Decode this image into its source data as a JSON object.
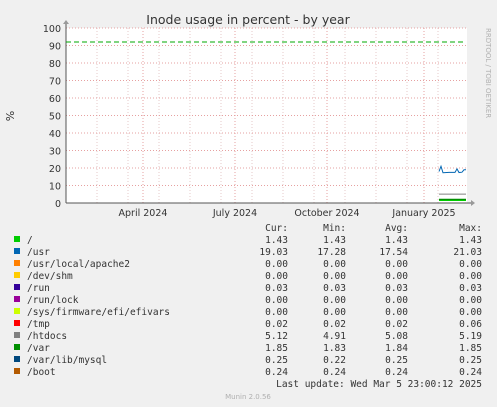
{
  "chart_data": {
    "type": "line",
    "title": "Inode usage in percent - by year",
    "ylabel": "%",
    "ylim": [
      0,
      100
    ],
    "yticks": [
      0,
      10,
      20,
      30,
      40,
      50,
      60,
      70,
      80,
      90,
      100
    ],
    "xtick_labels": [
      "April 2024",
      "July 2024",
      "October 2024",
      "January 2025"
    ],
    "grid": true,
    "side_label": "RRDTOOL / TOBI OETIKER",
    "warning_line": {
      "value": 92,
      "color": "#00aa00",
      "style": "dashed"
    },
    "legend_headers": [
      "Cur:",
      "Min:",
      "Avg:",
      "Max:"
    ],
    "series": [
      {
        "name": "/",
        "color": "#00cc00",
        "cur": "1.43",
        "min": "1.43",
        "avg": "1.43",
        "max": "1.43"
      },
      {
        "name": "/usr",
        "color": "#0066b3",
        "cur": "19.03",
        "min": "17.28",
        "avg": "17.54",
        "max": "21.03"
      },
      {
        "name": "/usr/local/apache2",
        "color": "#ff8000",
        "cur": "0.00",
        "min": "0.00",
        "avg": "0.00",
        "max": "0.00"
      },
      {
        "name": "/dev/shm",
        "color": "#ffcc00",
        "cur": "0.00",
        "min": "0.00",
        "avg": "0.00",
        "max": "0.00"
      },
      {
        "name": "/run",
        "color": "#330099",
        "cur": "0.03",
        "min": "0.03",
        "avg": "0.03",
        "max": "0.03"
      },
      {
        "name": "/run/lock",
        "color": "#990099",
        "cur": "0.00",
        "min": "0.00",
        "avg": "0.00",
        "max": "0.00"
      },
      {
        "name": "/sys/firmware/efi/efivars",
        "color": "#ccff00",
        "cur": "0.00",
        "min": "0.00",
        "avg": "0.00",
        "max": "0.00"
      },
      {
        "name": "/tmp",
        "color": "#ff0000",
        "cur": "0.02",
        "min": "0.02",
        "avg": "0.02",
        "max": "0.06"
      },
      {
        "name": "/htdocs",
        "color": "#808080",
        "cur": "5.12",
        "min": "4.91",
        "avg": "5.08",
        "max": "5.19"
      },
      {
        "name": "/var",
        "color": "#008f00",
        "cur": "1.85",
        "min": "1.83",
        "avg": "1.84",
        "max": "1.85"
      },
      {
        "name": "/var/lib/mysql",
        "color": "#00487d",
        "cur": "0.25",
        "min": "0.22",
        "avg": "0.25",
        "max": "0.25"
      },
      {
        "name": "/boot",
        "color": "#b35a00",
        "cur": "0.24",
        "min": "0.24",
        "avg": "0.24",
        "max": "0.24"
      }
    ],
    "last_update": "Last update: Wed Mar  5 23:00:12 2025",
    "footer": "Munin 2.0.56"
  }
}
